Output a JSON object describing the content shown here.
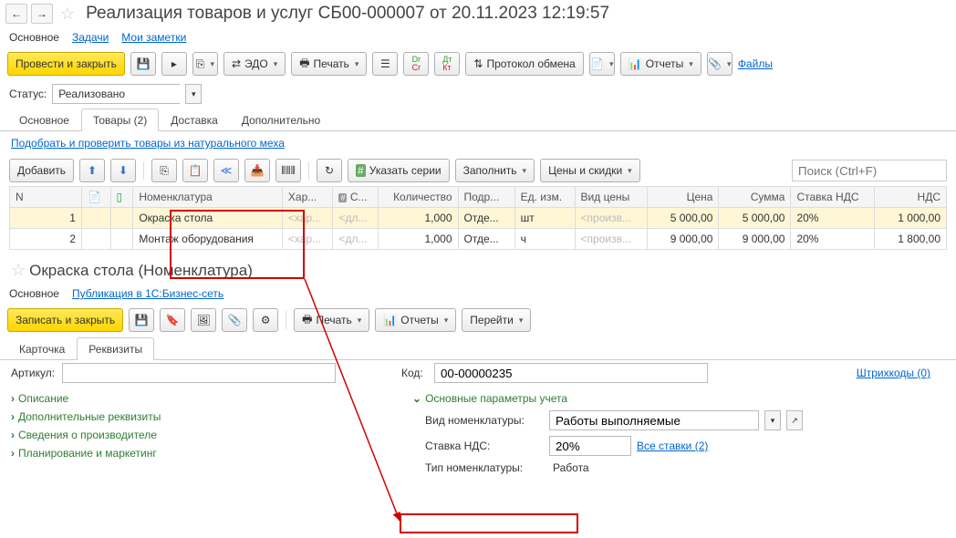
{
  "header": {
    "title": "Реализация товаров и услуг СБ00-000007 от 20.11.2023 12:19:57"
  },
  "subnav": {
    "main": "Основное",
    "tasks": "Задачи",
    "notes": "Мои заметки"
  },
  "toolbar": {
    "post_and_close": "Провести и закрыть",
    "edo": "ЭДО",
    "print": "Печать",
    "protocol": "Протокол обмена",
    "reports": "Отчеты",
    "files": "Файлы"
  },
  "status": {
    "label": "Статус:",
    "value": "Реализовано"
  },
  "doc_tabs": [
    "Основное",
    "Товары (2)",
    "Доставка",
    "Дополнительно"
  ],
  "active_doc_tab": 1,
  "pick_link": "Подобрать и проверить товары из натурального меха",
  "table_toolbar": {
    "add": "Добавить",
    "series": "Указать серии",
    "fill": "Заполнить",
    "prices": "Цены и скидки",
    "search_placeholder": "Поиск (Ctrl+F)"
  },
  "table": {
    "columns": [
      "N",
      "",
      "",
      "Номенклатура",
      "Хар...",
      "С...",
      "Количество",
      "Подр...",
      "Ед. изм.",
      "Вид цены",
      "Цена",
      "Сумма",
      "Ставка НДС",
      "НДС"
    ],
    "rows": [
      {
        "n": "1",
        "nom": "Окраска стола",
        "har": "<хар...",
        "s": "<дл...",
        "qty": "1,000",
        "podr": "Отде...",
        "unit": "шт",
        "pricetype": "<произв...",
        "price": "5 000,00",
        "sum": "5 000,00",
        "vat_rate": "20%",
        "vat": "1 000,00",
        "selected": true
      },
      {
        "n": "2",
        "nom": "Монтаж оборудования",
        "har": "<хар...",
        "s": "<дл...",
        "qty": "1,000",
        "podr": "Отде...",
        "unit": "ч",
        "pricetype": "<произв...",
        "price": "9 000,00",
        "sum": "9 000,00",
        "vat_rate": "20%",
        "vat": "1 800,00",
        "selected": false
      }
    ]
  },
  "detail": {
    "title": "Окраска стола (Номенклатура)",
    "subnav": {
      "main": "Основное",
      "publication": "Публикация в 1С:Бизнес-сеть"
    },
    "toolbar": {
      "save_and_close": "Записать и закрыть",
      "print": "Печать",
      "reports": "Отчеты",
      "goto": "Перейти"
    },
    "tabs": [
      "Карточка",
      "Реквизиты"
    ],
    "active_tab": 1,
    "article_label": "Артикул:",
    "article_value": "",
    "code_label": "Код:",
    "code_value": "00-00000235",
    "barcodes_link": "Штрихкоды (0)",
    "left_sections": [
      "Описание",
      "Дополнительные реквизиты",
      "Сведения о производителе",
      "Планирование и маркетинг"
    ],
    "right_section_title": "Основные параметры учета",
    "fields": {
      "kind_label": "Вид номенклатуры:",
      "kind_value": "Работы выполняемые",
      "vat_label": "Ставка НДС:",
      "vat_value": "20%",
      "vat_all_link": "Все ставки (2)",
      "type_label": "Тип номенклатуры:",
      "type_value": "Работа"
    }
  }
}
